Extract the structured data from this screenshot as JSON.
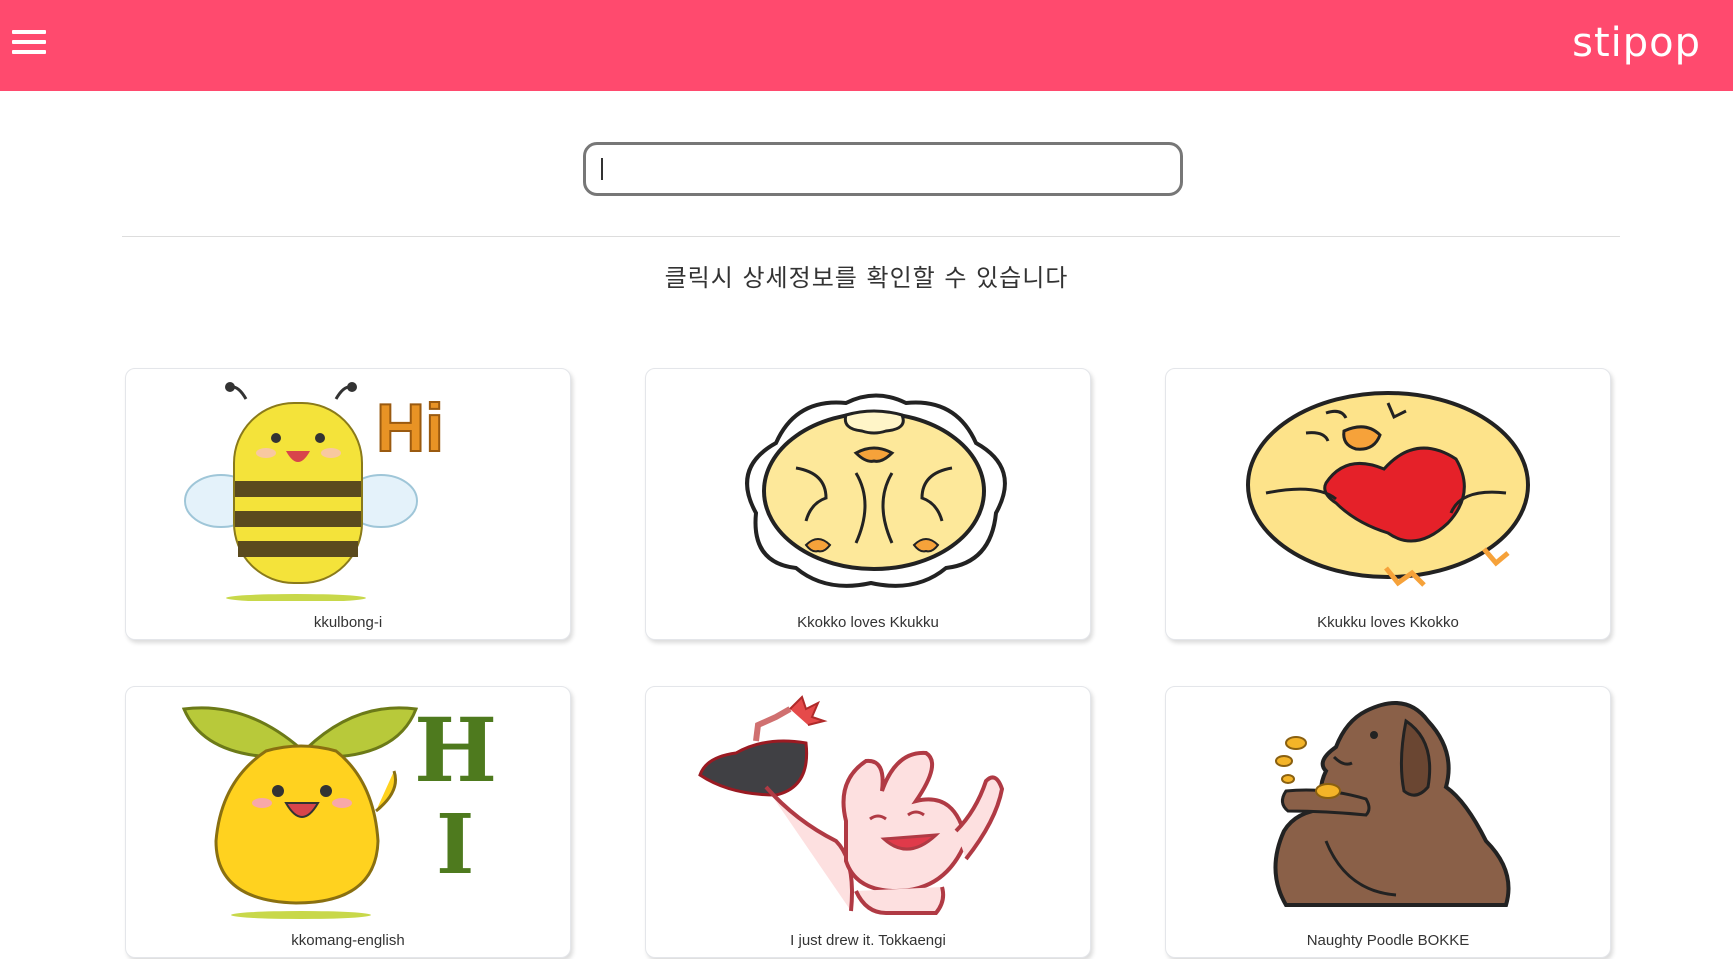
{
  "header": {
    "brand": "stipop",
    "menu_icon": "hamburger-menu-icon",
    "color": "#ff4a6e"
  },
  "search": {
    "value": "",
    "placeholder": ""
  },
  "hint": "클릭시 상세정보를 확인할 수 있습니다",
  "stickers": [
    {
      "title": "kkulbong-i",
      "icon": "bee-sticker"
    },
    {
      "title": "Kkokko loves Kkukku",
      "icon": "chick-sticker"
    },
    {
      "title": "Kkukku loves Kkokko",
      "icon": "chick-heart-sticker"
    },
    {
      "title": "kkomang-english",
      "icon": "sprout-sticker"
    },
    {
      "title": "I just drew it. Tokkaengi",
      "icon": "rabbit-bomb-sticker"
    },
    {
      "title": "Naughty Poodle BOKKE",
      "icon": "poodle-sticker"
    }
  ]
}
